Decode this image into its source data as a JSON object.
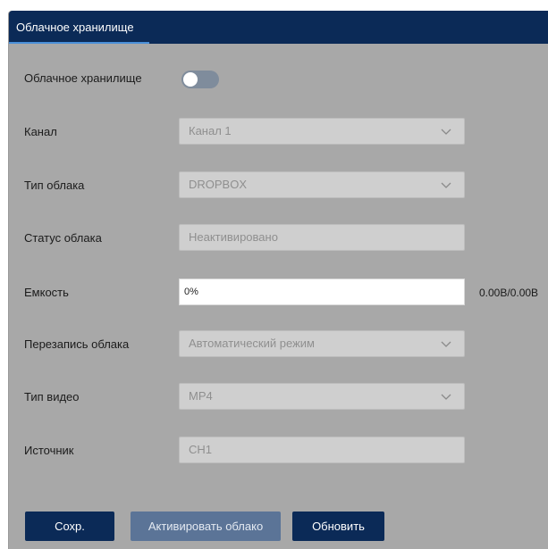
{
  "header": {
    "tab_label": "Облачное хранилище"
  },
  "form": {
    "cloud_storage": {
      "label": "Облачное хранилище",
      "enabled": false
    },
    "channel": {
      "label": "Канал",
      "value": "Канал 1"
    },
    "cloud_type": {
      "label": "Тип облака",
      "value": "DROPBOX"
    },
    "cloud_status": {
      "label": "Статус облака",
      "value": "Неактивировано"
    },
    "capacity": {
      "label": "Емкость",
      "percent_text": "0%",
      "percent": 0,
      "usage_text": "0.00B/0.00B"
    },
    "overwrite": {
      "label": "Перезапись облака",
      "value": "Автоматический режим"
    },
    "video_type": {
      "label": "Тип видео",
      "value": "MP4"
    },
    "source": {
      "label": "Источник",
      "value": "CH1"
    }
  },
  "buttons": {
    "save": "Сохр.",
    "activate": "Активировать облако",
    "refresh": "Обновить"
  },
  "colors": {
    "header_bg": "#0b2a57",
    "panel_bg": "#a8a8a8",
    "accent": "#4a90d9",
    "button_disabled": "#5b7497"
  },
  "icons": {
    "dropdown": "chevron-down-icon"
  }
}
